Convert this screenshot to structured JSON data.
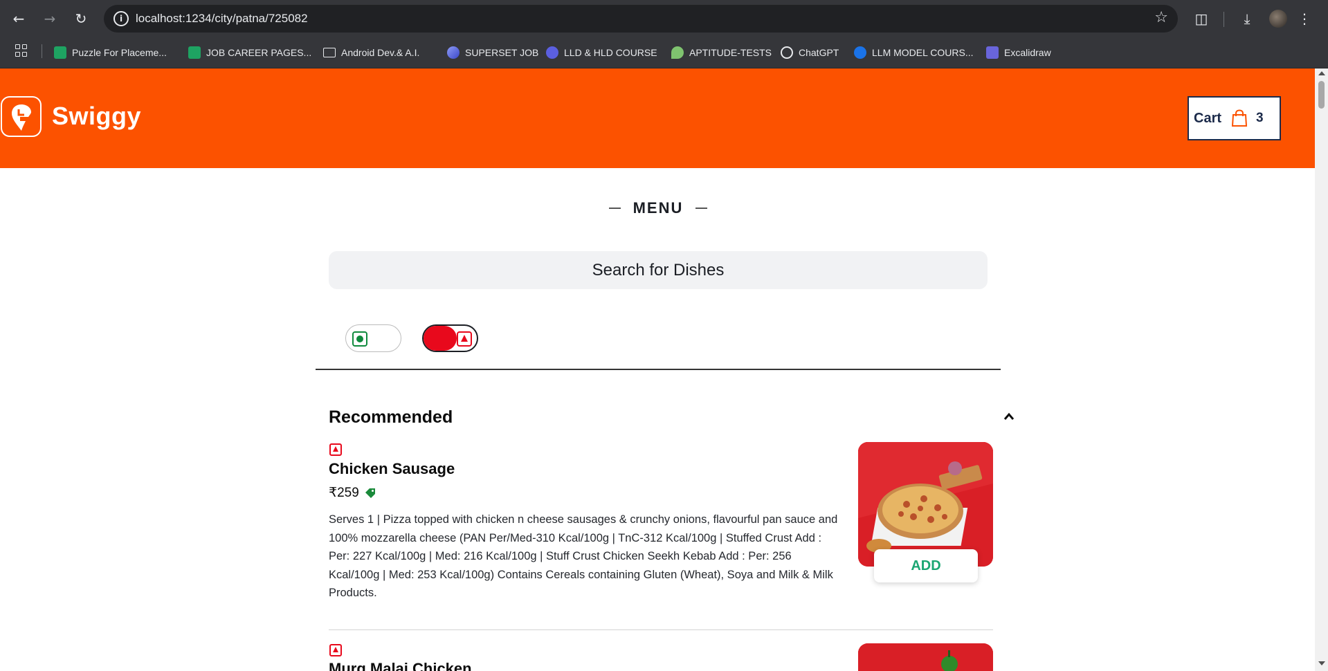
{
  "browser": {
    "url": "localhost:1234/city/patna/725082",
    "bookmarks": [
      {
        "label": "Puzzle For Placeme...",
        "icon": "sheets-icon",
        "color": "#1ea362"
      },
      {
        "label": "JOB  CAREER PAGES...",
        "icon": "sheets-icon",
        "color": "#1ea362"
      },
      {
        "label": "Android Dev.& A.I.",
        "icon": "folder-icon",
        "color": "#e8eaed"
      },
      {
        "label": "SUPERSET JOB",
        "icon": "superset-icon",
        "color": "#8e9cf6"
      },
      {
        "label": "LLD & HLD COURSE",
        "icon": "p-icon",
        "color": "#5b5fe0"
      },
      {
        "label": "APTITUDE-TESTS",
        "icon": "leaf-icon",
        "color": "#7fc36f"
      },
      {
        "label": "ChatGPT",
        "icon": "openai-icon",
        "color": "#e8eaed"
      },
      {
        "label": "LLM MODEL COURS...",
        "icon": "c-icon",
        "color": "#1a73e8"
      },
      {
        "label": "Excalidraw",
        "icon": "excalidraw-icon",
        "color": "#6965db"
      }
    ]
  },
  "header": {
    "brand": "Swiggy",
    "brand_color": "#fc5200",
    "cart_label": "Cart",
    "cart_count": "3"
  },
  "menu": {
    "title": "MENU",
    "search_placeholder": "Search for Dishes",
    "filters": {
      "veg": false,
      "nonveg": true
    }
  },
  "section": {
    "title": "Recommended",
    "items": [
      {
        "name": "Chicken Sausage",
        "price": "₹259",
        "description": "Serves 1 | Pizza topped with chicken n cheese sausages & crunchy onions, flavourful pan sauce and 100% mozzarella cheese (PAN Per/Med-310 Kcal/100g | TnC-312 Kcal/100g | Stuffed Crust Add : Per: 227 Kcal/100g | Med: 216 Kcal/100g | Stuff Crust Chicken Seekh Kebab Add : Per: 256 Kcal/100g | Med: 253 Kcal/100g) Contains Cereals containing Gluten (Wheat), Soya and Milk & Milk Products.",
        "add_label": "ADD"
      },
      {
        "name": "Murg Malai Chicken"
      }
    ]
  }
}
